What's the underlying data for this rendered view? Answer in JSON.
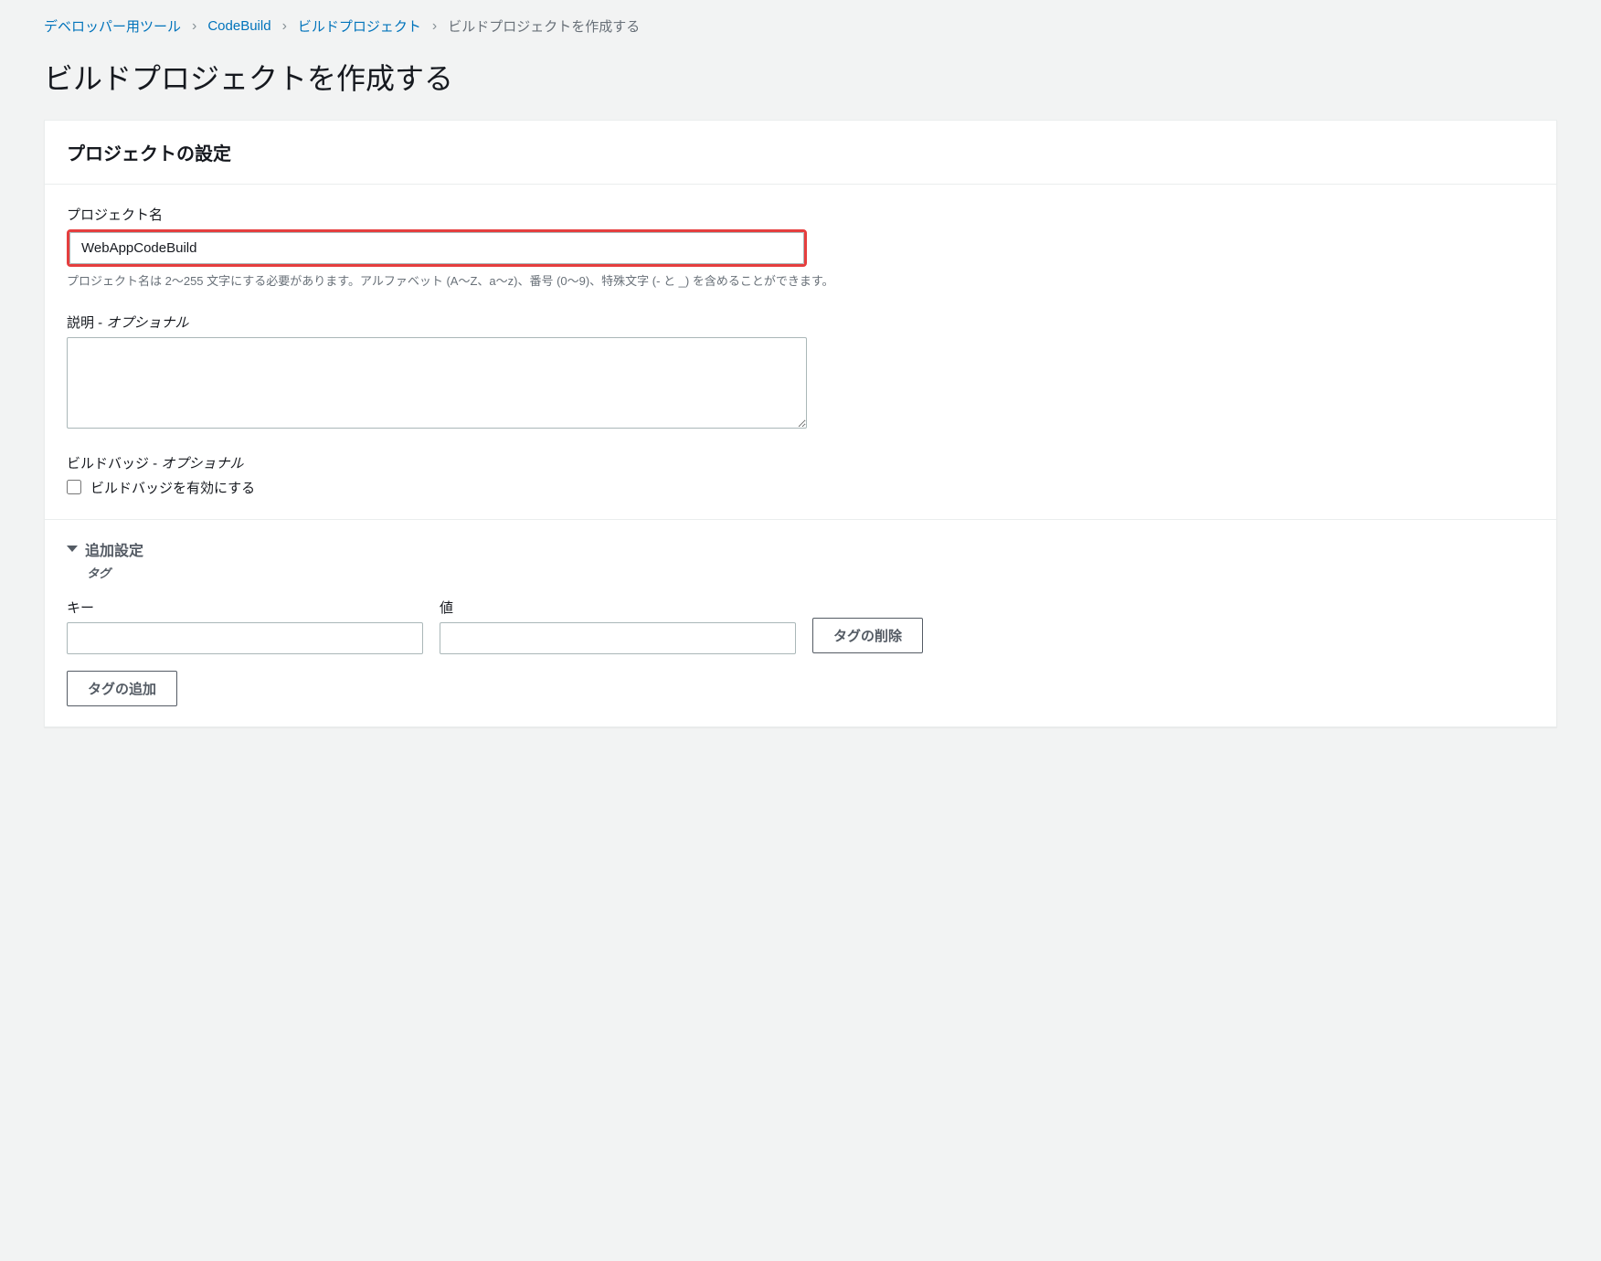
{
  "breadcrumb": {
    "items": [
      {
        "label": "デベロッパー用ツール",
        "link": true
      },
      {
        "label": "CodeBuild",
        "link": true
      },
      {
        "label": "ビルドプロジェクト",
        "link": true
      },
      {
        "label": "ビルドプロジェクトを作成する",
        "link": false
      }
    ]
  },
  "page_title": "ビルドプロジェクトを作成する",
  "panel": {
    "title": "プロジェクトの設定",
    "project_name": {
      "label": "プロジェクト名",
      "value": "WebAppCodeBuild",
      "help": "プロジェクト名は 2〜255 文字にする必要があります。アルファベット (A〜Z、a〜z)、番号 (0〜9)、特殊文字 (- と _) を含めることができます。"
    },
    "description": {
      "label_prefix": "説明 - ",
      "label_optional": "オプショナル",
      "value": ""
    },
    "build_badge": {
      "label_prefix": "ビルドバッジ - ",
      "label_optional": "オプショナル",
      "checkbox_label": "ビルドバッジを有効にする",
      "checked": false
    },
    "additional": {
      "title": "追加設定",
      "subtitle": "タグ",
      "tag_key_label": "キー",
      "tag_value_label": "値",
      "tag_key_value": "",
      "tag_value_value": "",
      "delete_tag_label": "タグの削除",
      "add_tag_label": "タグの追加"
    }
  }
}
